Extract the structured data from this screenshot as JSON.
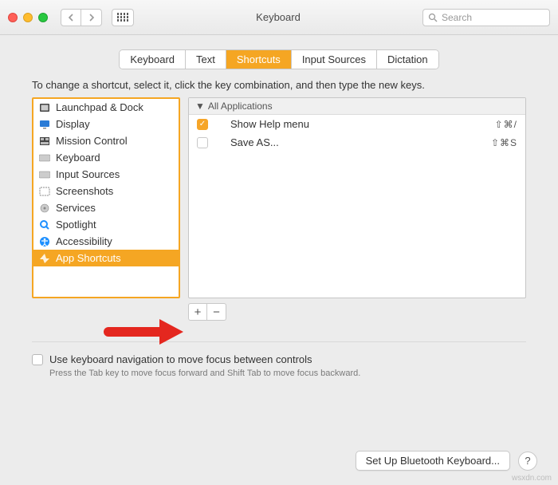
{
  "window": {
    "title": "Keyboard"
  },
  "search": {
    "placeholder": "Search"
  },
  "tabs": [
    {
      "label": "Keyboard"
    },
    {
      "label": "Text"
    },
    {
      "label": "Shortcuts"
    },
    {
      "label": "Input Sources"
    },
    {
      "label": "Dictation"
    }
  ],
  "instruction": "To change a shortcut, select it, click the key combination, and then type the new keys.",
  "categories": [
    {
      "label": "Launchpad & Dock"
    },
    {
      "label": "Display"
    },
    {
      "label": "Mission Control"
    },
    {
      "label": "Keyboard"
    },
    {
      "label": "Input Sources"
    },
    {
      "label": "Screenshots"
    },
    {
      "label": "Services"
    },
    {
      "label": "Spotlight"
    },
    {
      "label": "Accessibility"
    },
    {
      "label": "App Shortcuts"
    }
  ],
  "shortcuts_header": "All Applications",
  "shortcuts": [
    {
      "label": "Show Help menu",
      "keys": "⇧⌘/",
      "checked": true
    },
    {
      "label": "Save AS...",
      "keys": "⇧⌘S",
      "checked": false
    }
  ],
  "nav_option": {
    "label": "Use keyboard navigation to move focus between controls"
  },
  "nav_hint": "Press the Tab key to move focus forward and Shift Tab to move focus backward.",
  "footer": {
    "bluetooth": "Set Up Bluetooth Keyboard...",
    "help": "?"
  },
  "watermark": "wsxdn.com"
}
